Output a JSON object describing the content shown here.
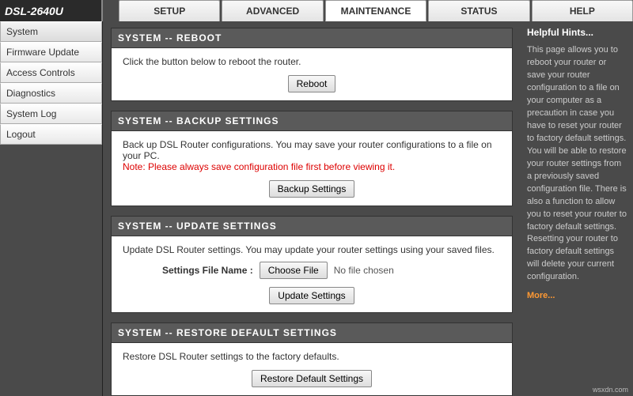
{
  "model": "DSL-2640U",
  "tabs": {
    "setup": "SETUP",
    "advanced": "ADVANCED",
    "maintenance": "MAINTENANCE",
    "status": "STATUS",
    "help": "HELP"
  },
  "sidebar": {
    "system": "System",
    "firmware": "Firmware Update",
    "access": "Access Controls",
    "diagnostics": "Diagnostics",
    "syslog": "System Log",
    "logout": "Logout"
  },
  "reboot": {
    "head": "SYSTEM -- REBOOT",
    "text": "Click the button below to reboot the router.",
    "button": "Reboot"
  },
  "backup": {
    "head": "SYSTEM -- BACKUP SETTINGS",
    "text": "Back up DSL Router configurations. You may save your router configurations to a file on your PC.",
    "note": "Note: Please always save configuration file first before viewing it.",
    "button": "Backup Settings"
  },
  "update": {
    "head": "SYSTEM -- UPDATE SETTINGS",
    "text": "Update DSL Router settings. You may update your router settings using your saved files.",
    "file_label": "Settings File Name :",
    "choose": "Choose File",
    "no_file": "No file chosen",
    "button": "Update Settings"
  },
  "restore": {
    "head": "SYSTEM -- RESTORE DEFAULT SETTINGS",
    "text": "Restore DSL Router settings to the factory defaults.",
    "button": "Restore Default Settings"
  },
  "hints": {
    "title": "Helpful Hints...",
    "body": "This page allows you to reboot your router or save your router configuration to a file on your computer as a precaution in case you have to reset your router to factory default settings. You will be able to restore your router settings from a previously saved configuration file. There is also a function to allow you to reset your router to factory default settings. Resetting your router to factory default settings will delete your current configuration.",
    "more": "More..."
  },
  "watermark": "wsxdn.com"
}
